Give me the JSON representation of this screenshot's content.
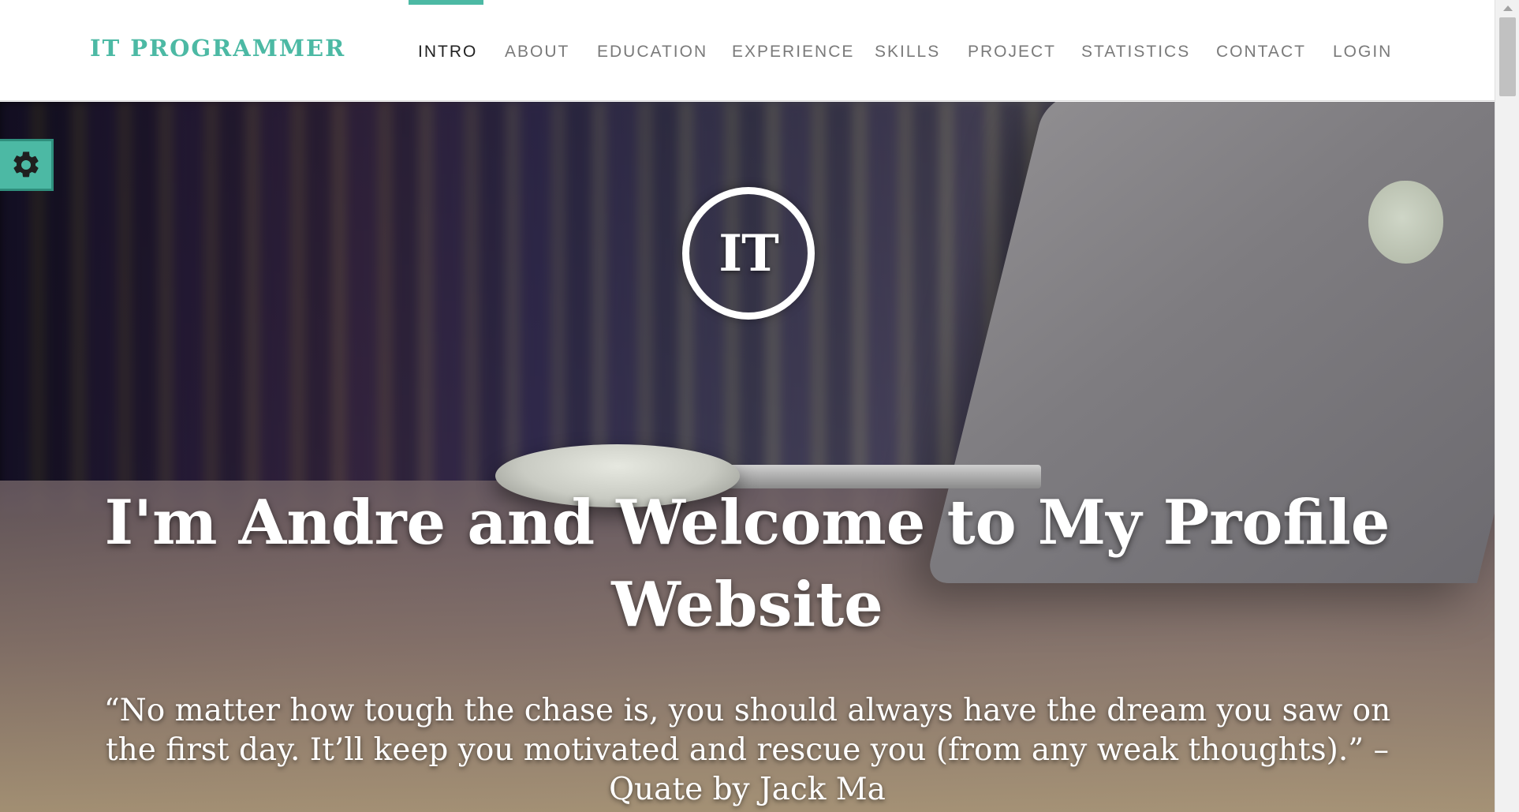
{
  "header": {
    "brand": "IT PROGRAMMER",
    "nav": [
      {
        "label": "INTRO",
        "active": true
      },
      {
        "label": "ABOUT",
        "active": false
      },
      {
        "label": "EDUCATION",
        "active": false
      },
      {
        "label": "EXPERIENCE",
        "active": false
      },
      {
        "label": "SKILLS",
        "active": false
      },
      {
        "label": "PROJECT",
        "active": false
      },
      {
        "label": "STATISTICS",
        "active": false
      },
      {
        "label": "CONTACT",
        "active": false
      },
      {
        "label": "LOGIN",
        "active": false
      }
    ]
  },
  "hero": {
    "logo_text": "IT",
    "headline": "I'm Andre and Welcome to My Profile Website",
    "quote": "“No matter how tough the chase is, you should always have the dream you saw on the first day. It’ll keep you motivated and rescue you (from any weak thoughts).” – Quate by Jack Ma"
  },
  "settings": {
    "icon": "gear-icon"
  },
  "colors": {
    "accent": "#4cb9a4",
    "nav_text": "#7a7a7a",
    "nav_active_text": "#222222",
    "hero_text": "#ffffff"
  }
}
